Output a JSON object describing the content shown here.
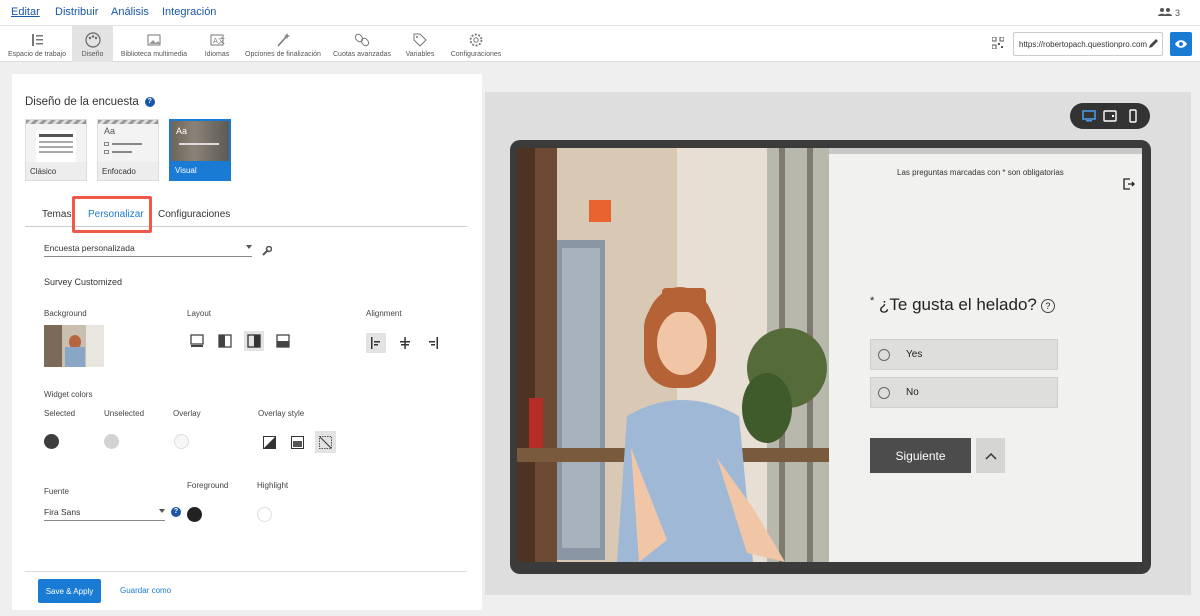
{
  "topnav": {
    "tabs": [
      "Editar",
      "Distribuir",
      "Análisis",
      "Integración"
    ],
    "users_count": "3"
  },
  "toolbar": {
    "items": [
      {
        "label": "Espacio de trabajo",
        "icon": "workspace-icon"
      },
      {
        "label": "Diseño",
        "icon": "palette-icon"
      },
      {
        "label": "Biblioteca multimedia",
        "icon": "image-icon"
      },
      {
        "label": "Idiomas",
        "icon": "languages-icon"
      },
      {
        "label": "Opciones de finalización",
        "icon": "magic-wand-icon"
      },
      {
        "label": "Cuotas avanzadas",
        "icon": "chain-icon"
      },
      {
        "label": "Variables",
        "icon": "tag-icon"
      },
      {
        "label": "Configuraciones",
        "icon": "gear-icon"
      }
    ],
    "url": "https://robertopach.questionpro.com"
  },
  "design": {
    "title": "Diseño de la encuesta",
    "templates": [
      "Clásico",
      "Enfocado",
      "Visual"
    ],
    "template_aa": "Aa",
    "subtabs": [
      "Temas",
      "Personalizar",
      "Configuraciones"
    ],
    "theme_select": "Encuesta personalizada",
    "section_title": "Survey Customized",
    "background_label": "Background",
    "layout_label": "Layout",
    "alignment_label": "Alignment",
    "widget_colors_label": "Widget colors",
    "selected_label": "Selected",
    "unselected_label": "Unselected",
    "overlay_label": "Overlay",
    "overlay_style_label": "Overlay style",
    "font_label": "Fuente",
    "font_value": "Fira Sans",
    "foreground_label": "Foreground",
    "highlight_label": "Highlight",
    "colors": {
      "selected": "#3d3d3d",
      "unselected": "#d2d2d2",
      "overlay": "#f7f7f7",
      "foreground": "#222222",
      "highlight": "#ffffff"
    },
    "save_label": "Save & Apply",
    "save_as_label": "Guardar como"
  },
  "preview": {
    "required_note": "Las preguntas marcadas con * son obligatorias",
    "question": "¿Te gusta el helado?",
    "asterisk": "*",
    "help_mark": "?",
    "options": [
      "Yes",
      "No"
    ],
    "next_label": "Siguiente"
  }
}
